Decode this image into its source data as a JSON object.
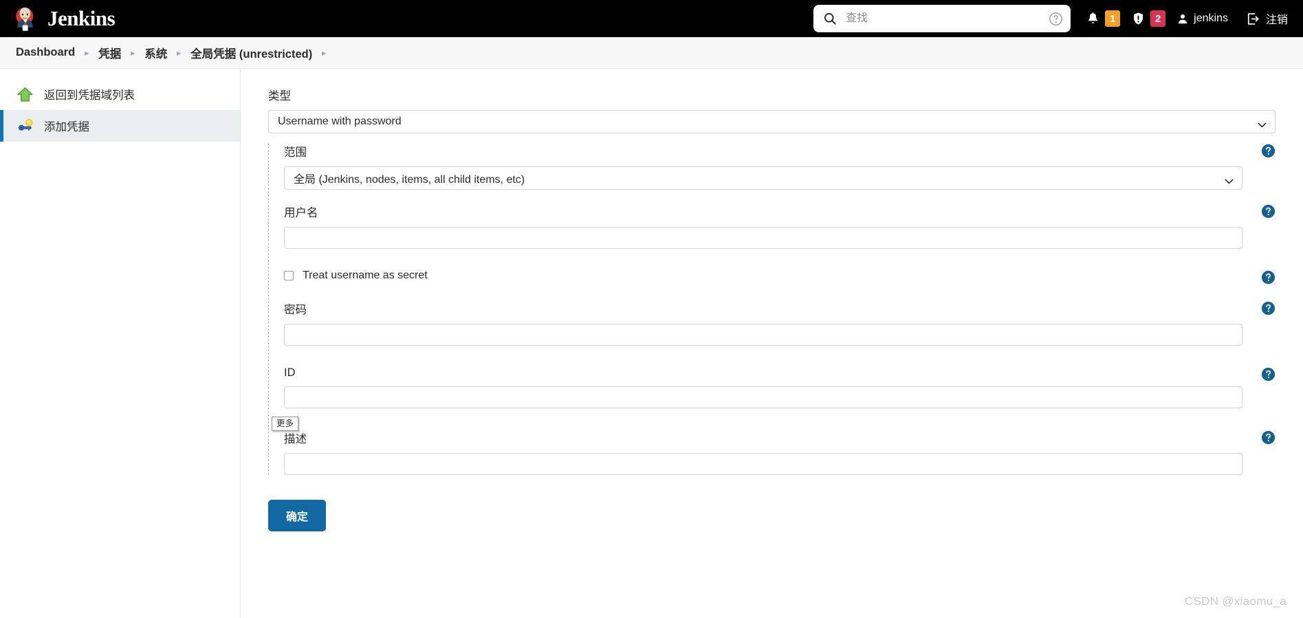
{
  "header": {
    "brand": "Jenkins",
    "brand_logo_icon": "jenkins-butler-logo",
    "search": {
      "placeholder": "查找",
      "value": "",
      "search_icon": "search-icon",
      "help_icon": "help-circle-icon"
    },
    "notifications": {
      "bell_icon": "bell-icon",
      "bell_count": "1",
      "bell_badge_color": "#f4a024",
      "security_icon": "shield-exclamation-icon",
      "security_count": "2",
      "security_badge_color": "#dc3251"
    },
    "user": {
      "icon": "person-icon",
      "name": "jenkins"
    },
    "logout": {
      "icon": "logout-arrow-icon",
      "label": "注销"
    }
  },
  "breadcrumb": {
    "separator": "▸",
    "items": [
      {
        "label": "Dashboard"
      },
      {
        "label": "凭据"
      },
      {
        "label": "系统"
      },
      {
        "label": "全局凭据 (unrestricted)"
      }
    ]
  },
  "sidebar": {
    "items": [
      {
        "label": "返回到凭据域列表",
        "icon": "up-arrow-green-icon",
        "active": false
      },
      {
        "label": "添加凭据",
        "icon": "key-icon",
        "active": true
      }
    ],
    "active_accent_color": "#1274b8",
    "active_bg_color": "#e9eef1"
  },
  "form": {
    "type": {
      "label": "类型",
      "value": "Username with password",
      "chevron_icon": "chevron-down-icon"
    },
    "scope": {
      "label": "范围",
      "value": "全局 (Jenkins, nodes, items, all child items, etc)",
      "chevron_icon": "chevron-down-icon",
      "help_icon": "help-circle-icon"
    },
    "username": {
      "label": "用户名",
      "value": "",
      "help_icon": "help-circle-icon"
    },
    "treat_username_as_secret": {
      "label": "Treat username as secret",
      "checked": false,
      "help_icon": "help-circle-icon"
    },
    "password": {
      "label": "密码",
      "value": "",
      "help_icon": "help-circle-icon"
    },
    "id": {
      "label": "ID",
      "value": "",
      "help_icon": "help-circle-icon"
    },
    "more_tooltip": "更多",
    "description": {
      "label": "描述",
      "value": "",
      "help_icon": "help-circle-icon"
    },
    "submit": {
      "label": "确定",
      "color": "#1268a3"
    }
  },
  "watermark": "CSDN @xiaomu_a"
}
